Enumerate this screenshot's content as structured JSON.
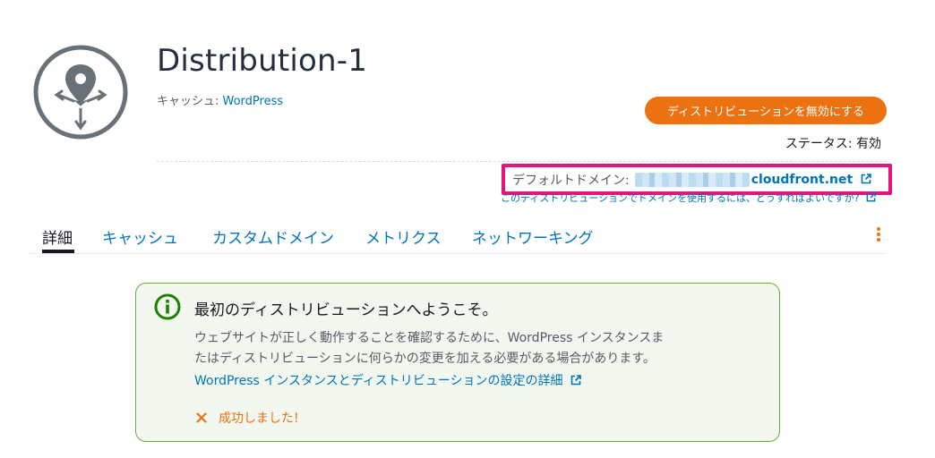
{
  "header": {
    "title": "Distribution-1",
    "cache_label": "キャッシュ: ",
    "cache_link": "WordPress"
  },
  "actions": {
    "disable_button": "ディストリビューションを無効にする"
  },
  "status": {
    "text": "ステータス: 有効"
  },
  "domain": {
    "label": "デフォルトドメイン:",
    "link_text": "cloudfront.net",
    "help_link": "このディストリビューションでドメインを使用するには、どうすればよいですか?"
  },
  "tabs": [
    {
      "label": "詳細",
      "active": true
    },
    {
      "label": "キャッシュ"
    },
    {
      "label": "カスタムドメイン"
    },
    {
      "label": "メトリクス"
    },
    {
      "label": "ネットワーキング"
    }
  ],
  "flash": {
    "title": "最初のディストリビューションへようこそ。",
    "body_line1": "ウェブサイトが正しく動作することを確認するために、WordPress インスタンスま",
    "body_line2": "たはディストリビューションに何らかの変更を加える必要がある場合があります。",
    "link": "WordPress インスタンスとディストリビューションの設定の詳細",
    "success": "成功しました!"
  },
  "colors": {
    "accent": "#ec7211",
    "link": "#0073bb",
    "highlight": "#e7157b",
    "flash_border": "#6aaf35"
  },
  "icons": [
    "distribution-logo-icon",
    "external-link-icon",
    "more-options-icon",
    "info-icon",
    "close-x-icon"
  ]
}
